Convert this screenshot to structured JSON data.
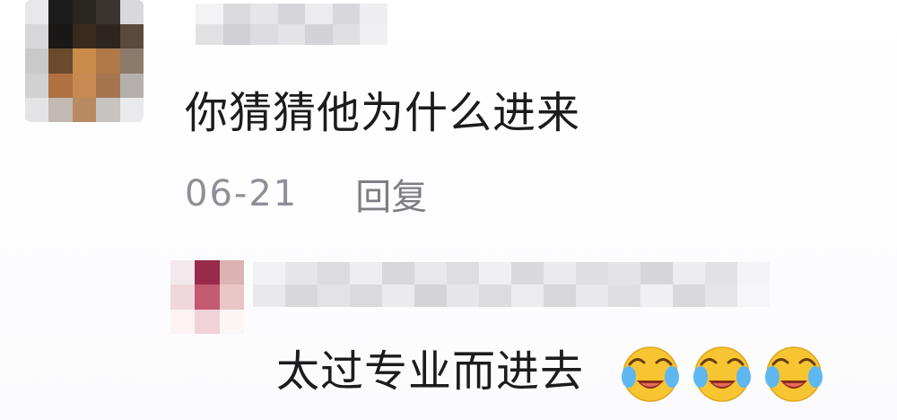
{
  "comment": {
    "text": "你猜猜他为什么进来",
    "date": "06-21",
    "reply_label": "回复"
  },
  "reply": {
    "text": "太过专业而进去",
    "emojis": [
      "crying-laughing-emoji",
      "crying-laughing-emoji",
      "crying-laughing-emoji"
    ]
  },
  "colors": {
    "text": "#1c1c1e",
    "meta": "#8f8f97",
    "emoji_face": "#f7c531"
  }
}
